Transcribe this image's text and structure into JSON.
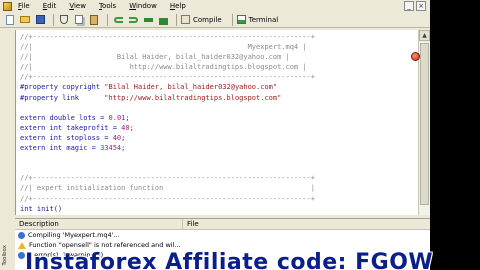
{
  "menu": [
    "File",
    "Edit",
    "View",
    "Tools",
    "Window",
    "Help"
  ],
  "toolbar": {
    "compile_label": "Compile",
    "terminal_label": "Terminal"
  },
  "code_lines": [
    [
      {
        "c": "cmt",
        "t": "//+------------------------------------------------------------------+"
      }
    ],
    [
      {
        "c": "cmt",
        "t": "//|                                                   Myexpert.mq4 |"
      }
    ],
    [
      {
        "c": "cmt",
        "t": "//|                    Bilal Haider, bilal_haider032@yahoo.com |"
      }
    ],
    [
      {
        "c": "cmt",
        "t": "//|                       http://www.bilaltradingtips.blogspot.com |"
      }
    ],
    [
      {
        "c": "cmt",
        "t": "//+------------------------------------------------------------------+"
      }
    ],
    [
      {
        "c": "dir",
        "t": "#property copyright "
      },
      {
        "c": "str",
        "t": "\"Bilal Haider, bilal_haider032@yahoo.com\""
      }
    ],
    [
      {
        "c": "dir",
        "t": "#property link      "
      },
      {
        "c": "str",
        "t": "\"http://www.bilaltradingtips.blogspot.com\""
      }
    ],
    [
      {
        "c": "txt",
        "t": ""
      }
    ],
    [
      {
        "c": "kw",
        "t": "extern double "
      },
      {
        "c": "txt",
        "t": "lots = "
      },
      {
        "c": "num",
        "t": "0.01"
      },
      {
        "c": "txt",
        "t": ";"
      }
    ],
    [
      {
        "c": "kw",
        "t": "extern int "
      },
      {
        "c": "txt",
        "t": "takeprofit = "
      },
      {
        "c": "num",
        "t": "40"
      },
      {
        "c": "txt",
        "t": ";"
      }
    ],
    [
      {
        "c": "kw",
        "t": "extern int "
      },
      {
        "c": "txt",
        "t": "stoploss = "
      },
      {
        "c": "num",
        "t": "40"
      },
      {
        "c": "txt",
        "t": ";"
      }
    ],
    [
      {
        "c": "kw",
        "t": "extern int "
      },
      {
        "c": "txt",
        "t": "magic = "
      },
      {
        "c": "num",
        "t": "33454"
      },
      {
        "c": "txt",
        "t": ";"
      }
    ],
    [
      {
        "c": "txt",
        "t": ""
      }
    ],
    [
      {
        "c": "txt",
        "t": ""
      }
    ],
    [
      {
        "c": "cmt",
        "t": "//+------------------------------------------------------------------+"
      }
    ],
    [
      {
        "c": "cmt",
        "t": "//| expert initialization function                                   |"
      }
    ],
    [
      {
        "c": "cmt",
        "t": "//+------------------------------------------------------------------+"
      }
    ],
    [
      {
        "c": "kw",
        "t": "int "
      },
      {
        "c": "txt",
        "t": "init()"
      }
    ],
    [
      {
        "c": "txt",
        "t": "  {"
      }
    ],
    [
      {
        "c": "cmt",
        "t": "//----"
      }
    ]
  ],
  "panel": {
    "col_description": "Description",
    "col_file": "File",
    "rows": [
      {
        "icon": "info-icon",
        "text": "Compiling 'Myexpert.mq4'..."
      },
      {
        "icon": "warning-icon",
        "text": "Function \"opensell\" is not referenced and wil..."
      },
      {
        "icon": "info-icon",
        "text": "0 error(s), 1 warning(s)"
      }
    ],
    "side_label": "Toolbox"
  },
  "overlay_text": "Instaforex Affiliate code: FGOW",
  "colors": {
    "frame": "#ece9d8",
    "overlay": "#0b1f8a",
    "comment": "#8c8c8c",
    "keyword": "#1a1aa8",
    "string": "#9c1a1a",
    "number": "#a02080"
  }
}
